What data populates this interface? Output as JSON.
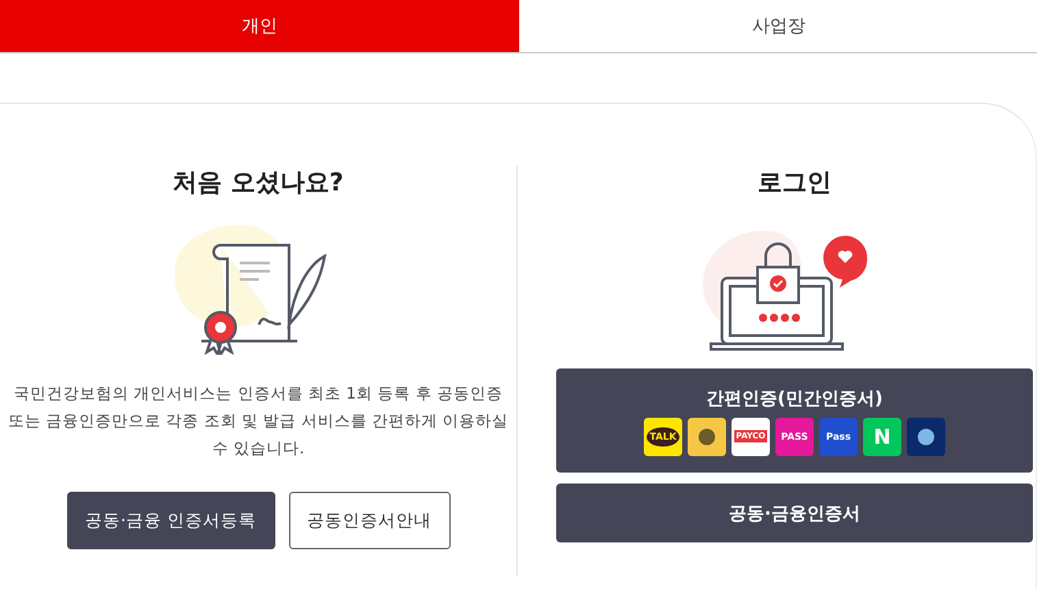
{
  "tabs": [
    {
      "label": "개인",
      "selected": true
    },
    {
      "label": "사업장",
      "selected": false
    }
  ],
  "first_visit": {
    "title": "처음 오셨나요?",
    "description": "국민건강보험의 개인서비스는 인증서를 최초 1회 등록 후 공동인증 또는 금융인증만으로 각종 조회 및 발급 서비스를 간편하게 이용하실 수 있습니다.",
    "buttons": [
      {
        "label": "공동·금융 인증서등록",
        "kind": "primary"
      },
      {
        "label": "공동인증서안내",
        "kind": "outline"
      }
    ]
  },
  "login": {
    "title": "로그인",
    "simple_auth": {
      "label": "간편인증(민간인증서)",
      "providers": [
        {
          "kind": "talk",
          "label": "TALK",
          "color": "#fee500"
        },
        {
          "kind": "kb",
          "color": "#f6c744"
        },
        {
          "kind": "payco",
          "label": "PAYCO",
          "color": "#ffffff"
        },
        {
          "kind": "pass",
          "label": "PASS",
          "color": "#e5179b"
        },
        {
          "kind": "samsung",
          "label": "Pass",
          "color": "#1f4fcf"
        },
        {
          "kind": "naver",
          "label": "N",
          "color": "#03c75a"
        },
        {
          "kind": "shinhan",
          "color": "#0a2a6b"
        }
      ]
    },
    "certificate_button": "공동·금융인증서"
  }
}
